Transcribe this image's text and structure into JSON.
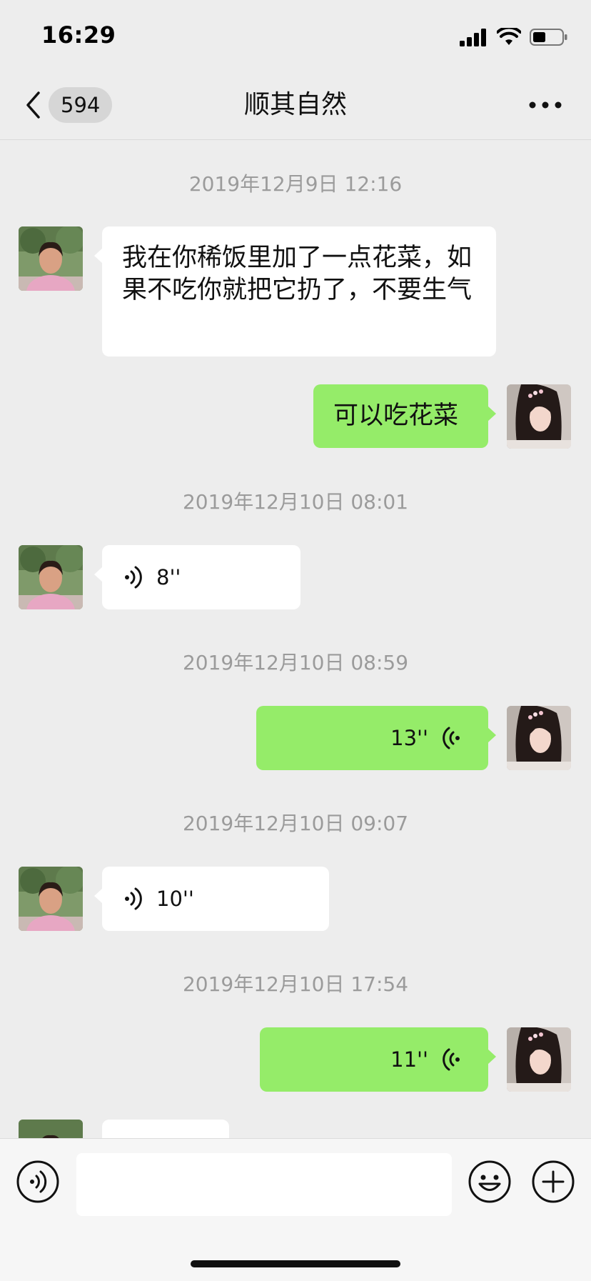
{
  "status_bar": {
    "time": "16:29",
    "signal_icon": "signal-bars-icon",
    "wifi_icon": "wifi-icon",
    "battery_icon": "battery-icon"
  },
  "nav": {
    "back_icon": "chevron-left-icon",
    "unread_count": "594",
    "title": "顺其自然",
    "more_icon": "more-dots-icon"
  },
  "messages": [
    {
      "type": "time",
      "text": "2019年12月9日 12:16"
    },
    {
      "type": "text",
      "direction": "incoming",
      "text": "我在你稀饭里加了一点花菜，如果不吃你就把它扔了，不要生气"
    },
    {
      "type": "text",
      "direction": "outgoing",
      "text": "可以吃花菜"
    },
    {
      "type": "time",
      "text": "2019年12月10日 08:01"
    },
    {
      "type": "voice",
      "direction": "incoming",
      "duration": "8''"
    },
    {
      "type": "time",
      "text": "2019年12月10日 08:59"
    },
    {
      "type": "voice",
      "direction": "outgoing",
      "duration": "13''"
    },
    {
      "type": "time",
      "text": "2019年12月10日 09:07"
    },
    {
      "type": "voice",
      "direction": "incoming",
      "duration": "10''"
    },
    {
      "type": "time",
      "text": "2019年12月10日 17:54"
    },
    {
      "type": "voice",
      "direction": "outgoing",
      "duration": "11''"
    }
  ],
  "input_bar": {
    "voice_icon": "voice-mode-icon",
    "input_value": "",
    "emoji_icon": "emoji-icon",
    "plus_icon": "plus-icon"
  },
  "colors": {
    "background": "#ededed",
    "outgoing_bubble": "#95ec69",
    "incoming_bubble": "#ffffff",
    "timestamp_text": "#9b9b9b"
  }
}
